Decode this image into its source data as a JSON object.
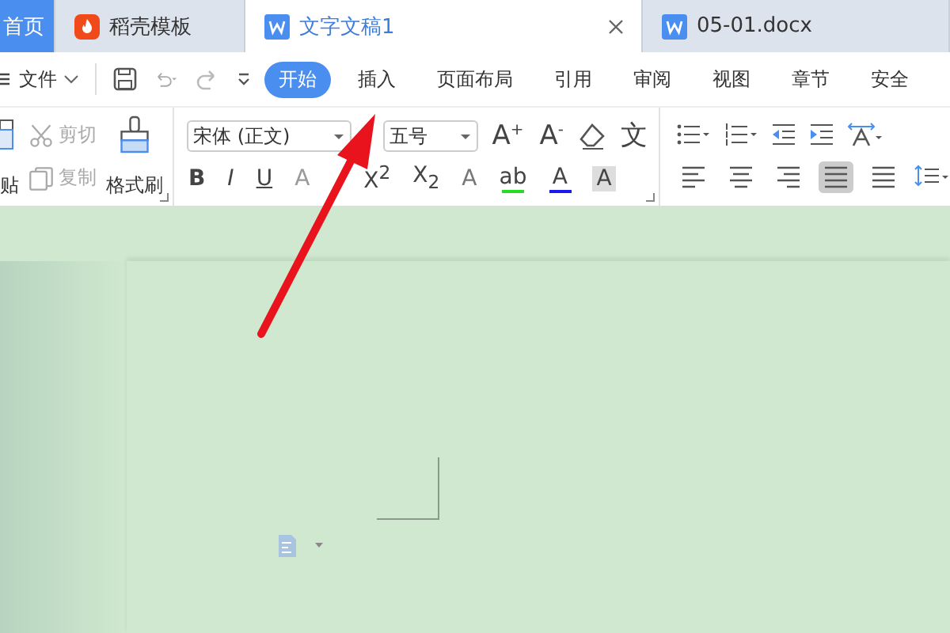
{
  "tabs": [
    {
      "label": "首页",
      "kind": "home",
      "selected": false
    },
    {
      "label": "稻壳模板",
      "kind": "docer",
      "selected": false
    },
    {
      "label": "文字文稿1",
      "kind": "doc",
      "selected": true,
      "closable": true
    },
    {
      "label": "05-01.docx",
      "kind": "doc",
      "selected": false
    }
  ],
  "menu": {
    "file_label": "文件",
    "ribbon_tabs": [
      {
        "label": "开始",
        "selected": true
      },
      {
        "label": "插入",
        "selected": false
      },
      {
        "label": "页面布局",
        "selected": false
      },
      {
        "label": "引用",
        "selected": false
      },
      {
        "label": "审阅",
        "selected": false
      },
      {
        "label": "视图",
        "selected": false
      },
      {
        "label": "章节",
        "selected": false
      },
      {
        "label": "安全",
        "selected": false
      }
    ]
  },
  "clipboard": {
    "paste": "贴",
    "cut": "剪切",
    "copy": "复制",
    "format_painter": "格式刷"
  },
  "font": {
    "family": "宋体 (正文)",
    "size": "五号",
    "tools": [
      {
        "kind": "grow",
        "label": "A$^{+}$"
      },
      {
        "kind": "shrink",
        "label": "A$^{-}$"
      },
      {
        "kind": "clear"
      },
      {
        "kind": "pinyin",
        "label": "文"
      }
    ],
    "format": [
      {
        "kind": "bold",
        "label": "B"
      },
      {
        "kind": "italic",
        "label": "I"
      },
      {
        "kind": "underline",
        "label": "U"
      },
      {
        "kind": "strike",
        "label": "A"
      },
      {
        "kind": "sup",
        "label": "X$^{2}$"
      },
      {
        "kind": "sub",
        "label": "X$_{2}$"
      },
      {
        "kind": "effect",
        "label": "A"
      },
      {
        "kind": "highlight",
        "label": "ab",
        "color": "#22dd22"
      },
      {
        "kind": "color",
        "label": "A",
        "color": "#1a1aee"
      },
      {
        "kind": "shade",
        "label": "A"
      }
    ]
  },
  "paragraph": {
    "align": [
      {
        "kind": "left",
        "selected": false
      },
      {
        "kind": "center",
        "selected": false
      },
      {
        "kind": "right",
        "selected": false
      },
      {
        "kind": "justify",
        "selected": true
      },
      {
        "kind": "distributed",
        "selected": false
      }
    ]
  }
}
